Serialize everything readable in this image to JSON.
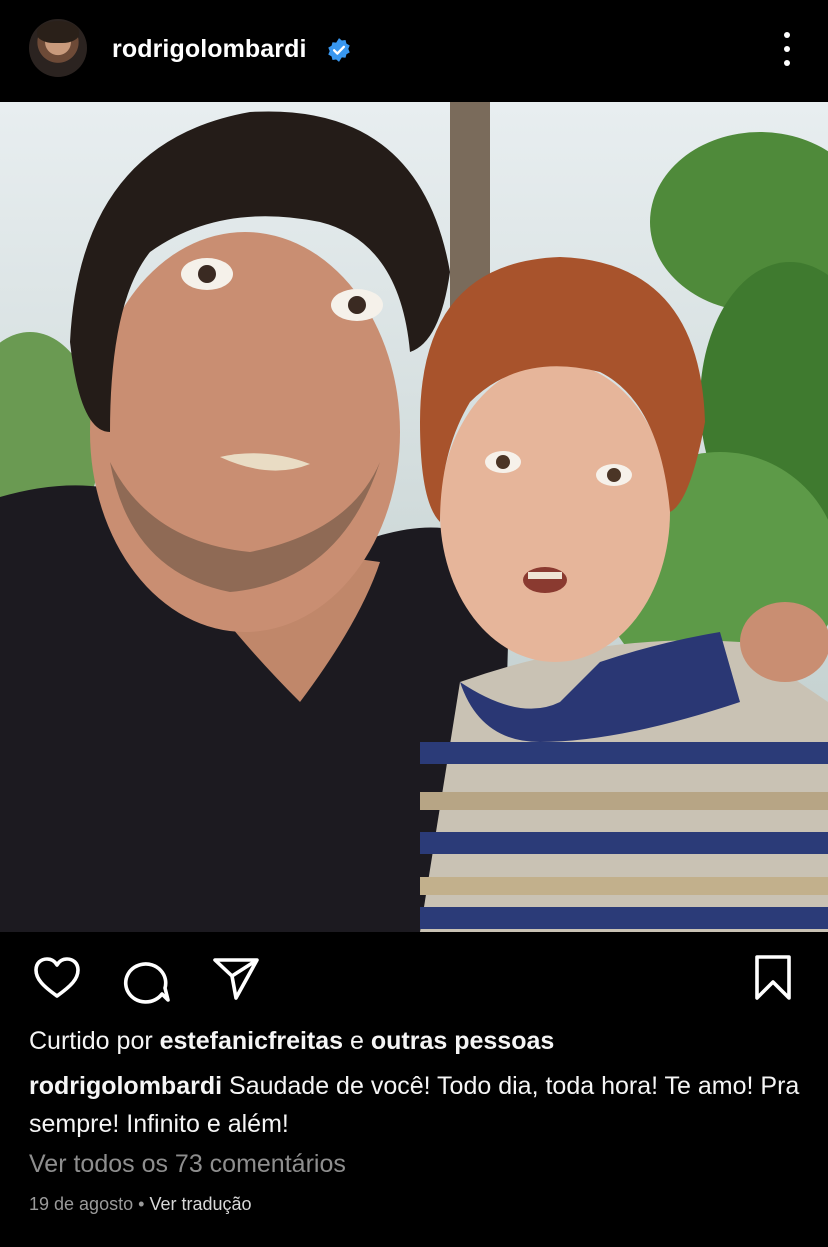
{
  "post": {
    "username": "rodrigolombardi",
    "verified_icon": "verified-badge-icon",
    "more_icon": "more-options-icon",
    "photo_alt": "",
    "actions": {
      "like_icon": "heart-icon",
      "comment_icon": "comment-icon",
      "share_icon": "share-icon",
      "save_icon": "bookmark-icon"
    },
    "likes": {
      "prefix": "Curtido por",
      "user": "estefanicfreitas",
      "connector": "e",
      "others": "outras pessoas"
    },
    "caption": {
      "author": "rodrigolombardi",
      "text": "Saudade de você! Todo dia, toda hora! Te amo! Pra sempre! Infinito e além!"
    },
    "comments_link": "Ver todos os 73 comentários",
    "date": "19 de agosto",
    "separator": "•",
    "translate_link": "Ver tradução"
  },
  "colors": {
    "background": "#000000",
    "text": "#f5f5f5",
    "muted": "#8e8e8e",
    "verified": "#3897f0"
  }
}
